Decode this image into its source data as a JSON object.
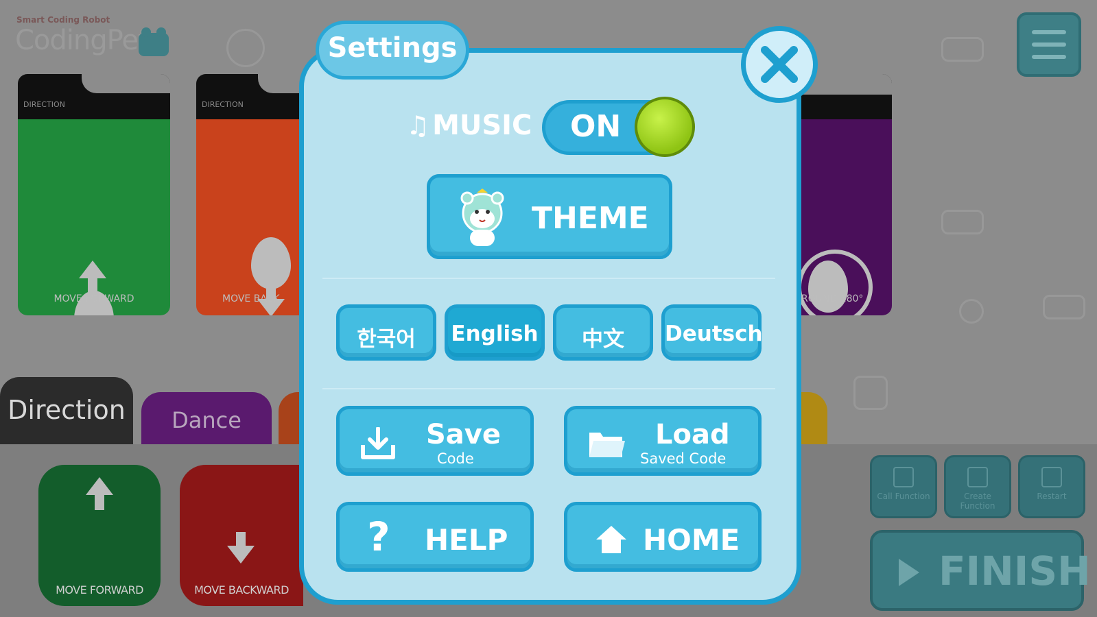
{
  "app": {
    "logo_tagline": "Smart Coding Robot",
    "logo_name": "CodingPet"
  },
  "cards": [
    {
      "category": "DIRECTION",
      "caption": "MOVE FORWARD",
      "color": "#1f8a3a"
    },
    {
      "category": "DIRECTION",
      "caption": "MOVE BACK",
      "color": "#c9421c"
    },
    {
      "category": "",
      "caption": "ROUND 180°",
      "color": "#4a0f5a"
    }
  ],
  "category_tabs": [
    {
      "label": "Direction",
      "color": "#2b2b2b"
    },
    {
      "label": "Dance",
      "color": "#5a1a6e"
    }
  ],
  "blocks": [
    {
      "caption": "MOVE FORWARD",
      "color": "#135d2b"
    },
    {
      "caption": "MOVE BACKWARD",
      "color": "#8a1616"
    }
  ],
  "tools": [
    {
      "label": "Call Function"
    },
    {
      "label": "Create Function"
    },
    {
      "label": "Restart"
    }
  ],
  "finish_label": "FINISH",
  "settings": {
    "title": "Settings",
    "music_label": "MUSIC",
    "music_state": "ON",
    "theme_label": "THEME",
    "languages": [
      {
        "label": "한국어",
        "active": false
      },
      {
        "label": "English",
        "active": true
      },
      {
        "label": "中文",
        "active": false
      },
      {
        "label": "Deutsch",
        "active": false
      }
    ],
    "save": {
      "title": "Save",
      "subtitle": "Code"
    },
    "load": {
      "title": "Load",
      "subtitle": "Saved Code"
    },
    "help_label": "HELP",
    "home_label": "HOME"
  },
  "colors": {
    "dialog_bg": "#b9e2ef",
    "dialog_border": "#1e9fcf",
    "button": "#44bde1",
    "button_active": "#1fa9d3",
    "toggle_knob": "#a6d624"
  }
}
